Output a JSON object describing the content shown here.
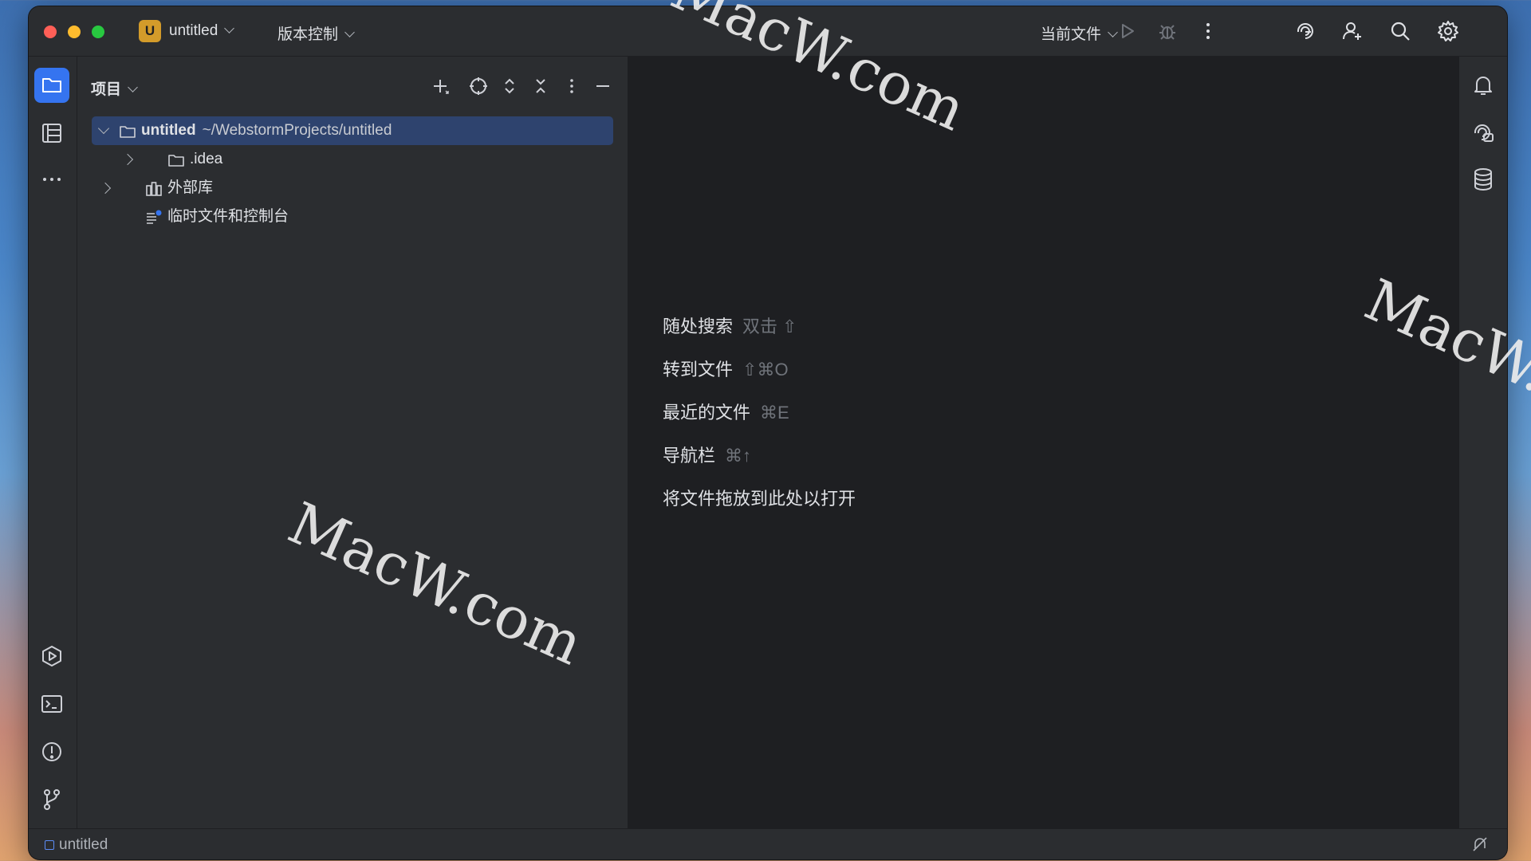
{
  "titlebar": {
    "project_badge": "U",
    "project_name": "untitled",
    "vcs_label": "版本控制",
    "run_config": "当前文件"
  },
  "project_panel": {
    "title": "项目",
    "tree": [
      {
        "name": "untitled",
        "path": "~/WebstormProjects/untitled",
        "expanded": true,
        "selected": true
      },
      {
        "name": ".idea",
        "expanded": false
      },
      {
        "name": "外部库",
        "expanded": false
      },
      {
        "name": "临时文件和控制台"
      }
    ]
  },
  "editor": {
    "hints": [
      {
        "label": "随处搜索",
        "shortcut": "双击 ⇧"
      },
      {
        "label": "转到文件",
        "shortcut": "⇧⌘O"
      },
      {
        "label": "最近的文件",
        "shortcut": "⌘E"
      },
      {
        "label": "导航栏",
        "shortcut": "⌘↑"
      },
      {
        "label": "将文件拖放到此处以打开",
        "shortcut": ""
      }
    ]
  },
  "statusbar": {
    "project": "untitled"
  },
  "watermark": "MacW.com",
  "colors": {
    "window_bg": "#2b2d30",
    "editor_bg": "#1e1f22",
    "accent": "#3574f0",
    "selection": "#2e436e",
    "project_badge": "#d39b2a"
  }
}
